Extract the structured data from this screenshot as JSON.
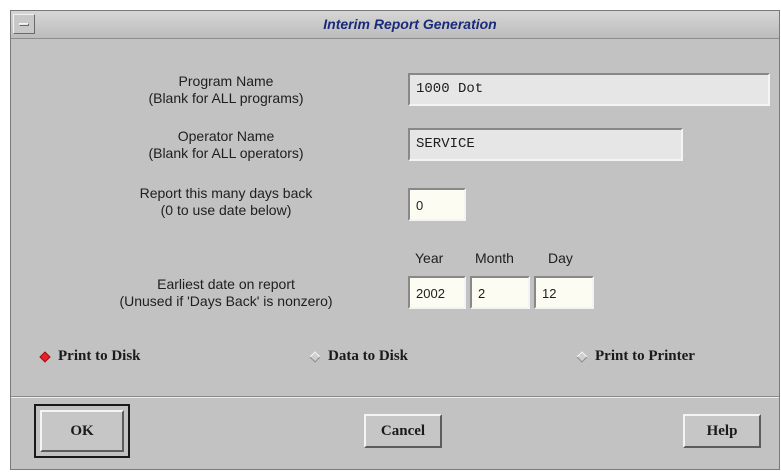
{
  "window": {
    "title": "Interim Report Generation"
  },
  "program": {
    "label_line1": "Program Name",
    "label_line2": "(Blank for ALL programs)",
    "value": "1000 Dot"
  },
  "operator": {
    "label_line1": "Operator Name",
    "label_line2": "(Blank for ALL operators)",
    "value": "SERVICE"
  },
  "days_back": {
    "label_line1": "Report this many days back",
    "label_line2": "(0 to use date below)",
    "value": "0"
  },
  "earliest_date": {
    "label_line1": "Earliest date on report",
    "label_line2": "(Unused if 'Days Back' is nonzero)",
    "year_header": "Year",
    "month_header": "Month",
    "day_header": "Day",
    "year": "2002",
    "month": "2",
    "day": "12"
  },
  "output_options": [
    {
      "label": "Print to Disk",
      "selected": true
    },
    {
      "label": "Data to Disk",
      "selected": false
    },
    {
      "label": "Print to Printer",
      "selected": false
    }
  ],
  "buttons": {
    "ok": "OK",
    "cancel": "Cancel",
    "help": "Help"
  },
  "colors": {
    "title_text": "#1a2a7a",
    "selected_radio": "#e8202a",
    "dialog_bg": "#c2c2c2"
  }
}
